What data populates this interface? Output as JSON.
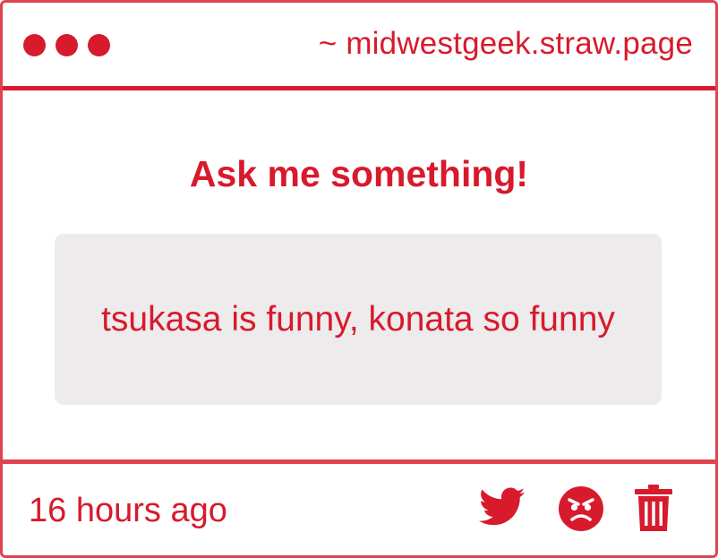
{
  "window": {
    "url": "~ midwestgeek.straw.page"
  },
  "main": {
    "heading": "Ask me something!",
    "question": "tsukasa is funny, konata so funny"
  },
  "footer": {
    "timestamp": "16 hours ago",
    "icons": [
      "twitter-icon",
      "angry-face-icon",
      "trash-icon"
    ]
  },
  "colors": {
    "accent": "#d71a2c",
    "border": "#e0434f",
    "question_bg": "#edebec"
  }
}
